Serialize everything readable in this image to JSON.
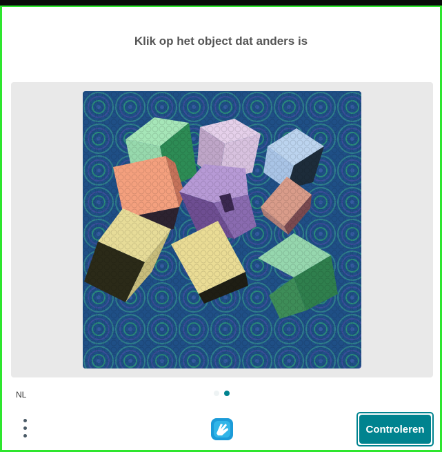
{
  "challenge": {
    "prompt": "Klik op het object dat anders is",
    "image_icon": "puzzle-image-of-cubes",
    "pages": {
      "total": 2,
      "current": 2
    }
  },
  "footer": {
    "language": "NL",
    "menu_icon": "vertical-ellipsis-icon",
    "logo_icon": "hcaptcha-hand-logo",
    "submit_label": "Controleren"
  },
  "colors": {
    "accent": "#00838f",
    "frame": "#2ee62e",
    "area_bg": "#e9e9e9",
    "prompt_text": "#555555"
  }
}
